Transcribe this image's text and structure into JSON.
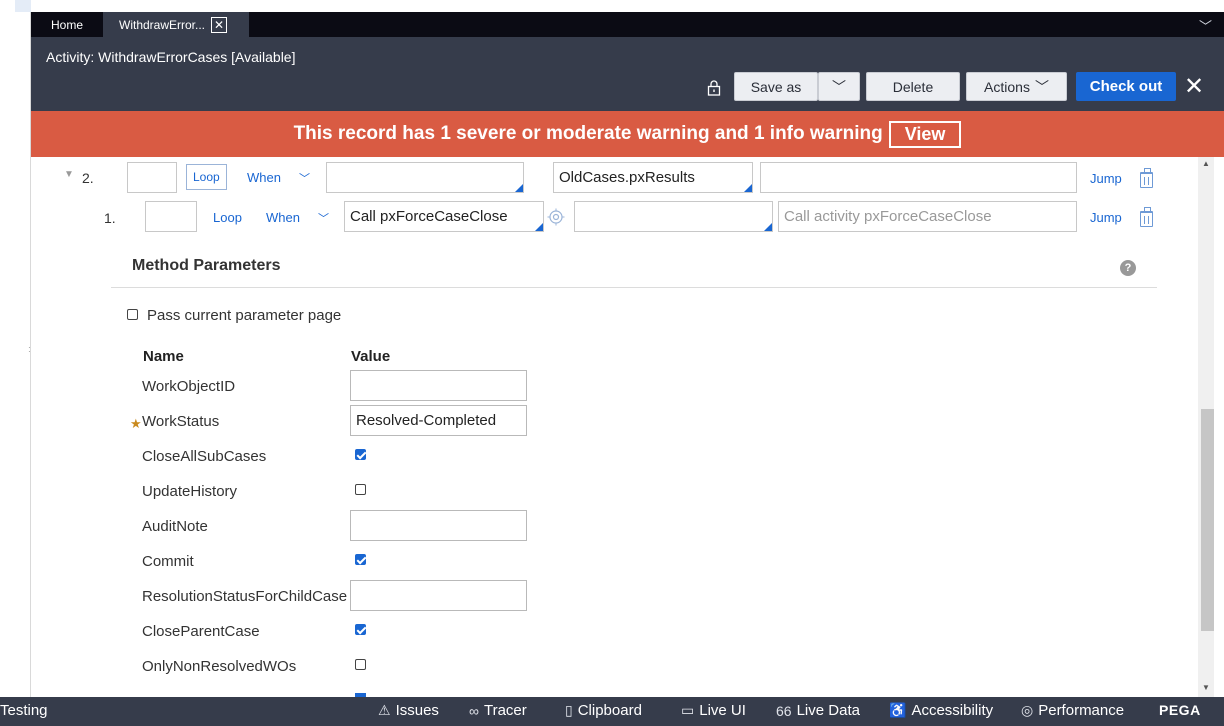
{
  "tabs": {
    "home": "Home",
    "active": "WithdrawError...",
    "close_glyph": "✕"
  },
  "header": {
    "title": "Activity: WithdrawErrorCases [Available]",
    "save_as": "Save as",
    "delete": "Delete",
    "actions": "Actions",
    "check_out": "Check out"
  },
  "banner": {
    "message": "This record has 1 severe or moderate warning and 1 info warning",
    "view": "View"
  },
  "steps": {
    "step2": {
      "number": "2.",
      "loop": "Loop",
      "when": "When",
      "method": "",
      "step_page": "OldCases.pxResults",
      "description": "",
      "jump": "Jump"
    },
    "step1": {
      "number": "1.",
      "loop": "Loop",
      "when": "When",
      "method": "Call pxForceCaseClose",
      "step_page": "",
      "description_placeholder": "Call activity pxForceCaseClose",
      "jump": "Jump"
    }
  },
  "method_params": {
    "title": "Method Parameters",
    "pass_current": "Pass current parameter page",
    "pass_current_checked": false,
    "col_name": "Name",
    "col_value": "Value",
    "rows": [
      {
        "name": "WorkObjectID",
        "type": "input",
        "value": ""
      },
      {
        "name": "WorkStatus",
        "type": "input",
        "value": "Resolved-Completed",
        "required": true
      },
      {
        "name": "CloseAllSubCases",
        "type": "checkbox",
        "checked": true
      },
      {
        "name": "UpdateHistory",
        "type": "checkbox",
        "checked": false
      },
      {
        "name": "AuditNote",
        "type": "input",
        "value": ""
      },
      {
        "name": "Commit",
        "type": "checkbox",
        "checked": true
      },
      {
        "name": "ResolutionStatusForChildCase",
        "type": "input",
        "value": ""
      },
      {
        "name": "CloseParentCase",
        "type": "checkbox",
        "checked": true
      },
      {
        "name": "OnlyNonResolvedWOs",
        "type": "checkbox",
        "checked": false
      }
    ]
  },
  "statusbar": {
    "testing": "Testing",
    "issues": "Issues",
    "tracer": "Tracer",
    "clipboard": "Clipboard",
    "live_ui": "Live UI",
    "live_data": "Live Data",
    "accessibility": "Accessibility",
    "performance": "Performance",
    "brand": "PEGA"
  },
  "colors": {
    "header_bg": "#363c4b",
    "tabbar_bg": "#0b0b14",
    "banner_bg": "#d95b43",
    "primary": "#1966d2"
  }
}
